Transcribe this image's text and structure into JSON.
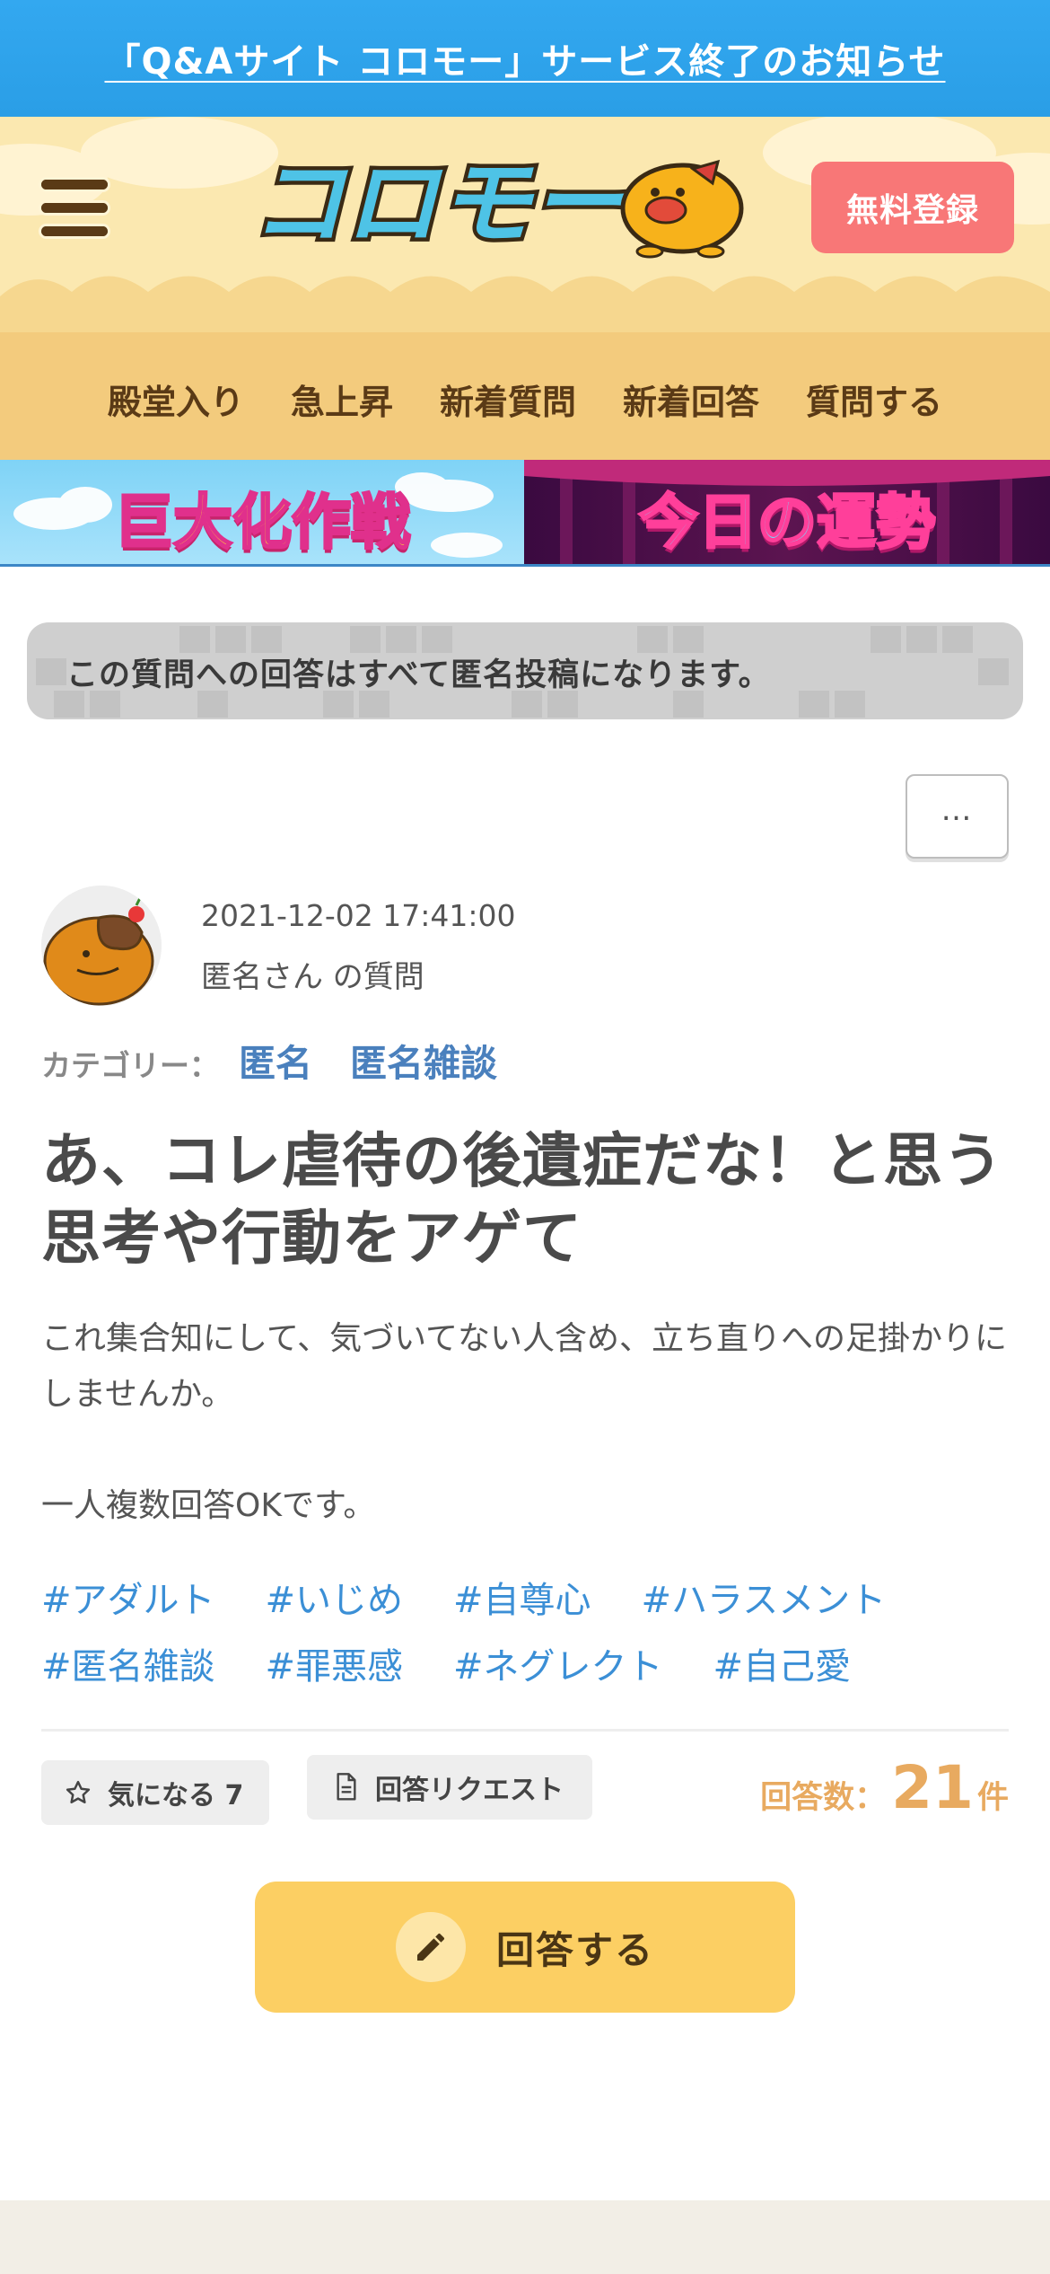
{
  "notice": {
    "text": "「Q&Aサイト コロモー」サービス終了のお知らせ"
  },
  "header": {
    "logo_text": "コロモー",
    "register_label": "無料登録"
  },
  "nav": {
    "items": [
      "殿堂入り",
      "急上昇",
      "新着質問",
      "新着回答",
      "質問する"
    ]
  },
  "banners": {
    "left": "巨大化作戦",
    "right": "今日の運勢"
  },
  "anon_notice": "この質問への回答はすべて匿名投稿になります。",
  "more_label": "…",
  "question": {
    "datetime": "2021-12-02 17:41:00",
    "author_line": "匿名さん の質問",
    "category_label": "カテゴリー：",
    "categories": [
      "匿名",
      "匿名雑談"
    ],
    "title": "あ、コレ虐待の後遺症だな！と思う思考や行動をアゲて",
    "body": [
      "これ集合知にして、気づいてない人含め、立ち直りへの足掛かりにしませんか。",
      "一人複数回答OKです。"
    ],
    "tags": [
      "#アダルト",
      "#いじめ",
      "#自尊心",
      "#ハラスメント",
      "#匿名雑談",
      "#罪悪感",
      "#ネグレクト",
      "#自己愛"
    ]
  },
  "actions": {
    "favorite_label": "気になる 7",
    "request_label": "回答リクエスト",
    "answer_count_label": "回答数：",
    "answer_count": "21",
    "answer_count_unit": "件",
    "answer_button": "回答する"
  },
  "colors": {
    "notice_bg": "#2a9ee6",
    "header_bg": "#fbe8b0",
    "nav_bg": "#f3cb7d",
    "register_bg": "#f87777",
    "link_blue": "#3b8fd6",
    "category_blue": "#4a80bd",
    "answer_count": "#e8aa60",
    "answer_button_bg": "#fccf63"
  }
}
